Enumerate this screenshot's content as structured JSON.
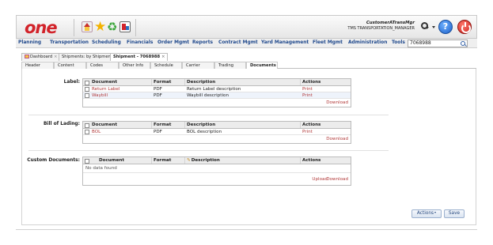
{
  "header": {
    "logo": "one",
    "user_name": "CustomerATransMgr",
    "user_role": "TMS TRANSPORTATION_MANAGER",
    "help_glyph": "?"
  },
  "menu": {
    "items": [
      "Planning",
      "Transportation",
      "Scheduling",
      "Financials",
      "Order Mgmt",
      "Reports",
      "Contract Mgmt",
      "Yard Management",
      "Fleet Mgmt",
      "Administration",
      "Tools"
    ],
    "search_value": "7068988"
  },
  "page_tabs": [
    {
      "label": "Dashboard"
    },
    {
      "label": "Shipments: by Shipment No"
    },
    {
      "label": "Shipment - 7068988"
    }
  ],
  "section_tabs": [
    "Header",
    "Content",
    "Codes",
    "Other Info",
    "Schedule",
    "Carrier",
    "Trading",
    "Documents"
  ],
  "columns": {
    "document": "Document",
    "format": "Format",
    "description": "Description",
    "actions": "Actions"
  },
  "sections": {
    "label": {
      "title": "Label:",
      "rows": [
        {
          "document": "Return Label",
          "format": "PDF",
          "description": "Return Label description",
          "action": "Print"
        },
        {
          "document": "Waybill",
          "format": "PDF",
          "description": "Waybill description",
          "action": "Print"
        }
      ],
      "footer": "Download"
    },
    "bol": {
      "title": "Bill of Lading:",
      "rows": [
        {
          "document": "BOL",
          "format": "PDF",
          "description": "BOL description",
          "action": "Print"
        }
      ],
      "footer": "Download"
    },
    "custom": {
      "title": "Custom Documents:",
      "empty_text": "No data found",
      "upload": "Upload",
      "footer": "Download"
    }
  },
  "buttons": {
    "actions": "Actions",
    "save": "Save"
  },
  "colors": {
    "brand_red": "#d2232a",
    "menu_blue": "#214a8d",
    "link_red": "#b23a3a"
  }
}
